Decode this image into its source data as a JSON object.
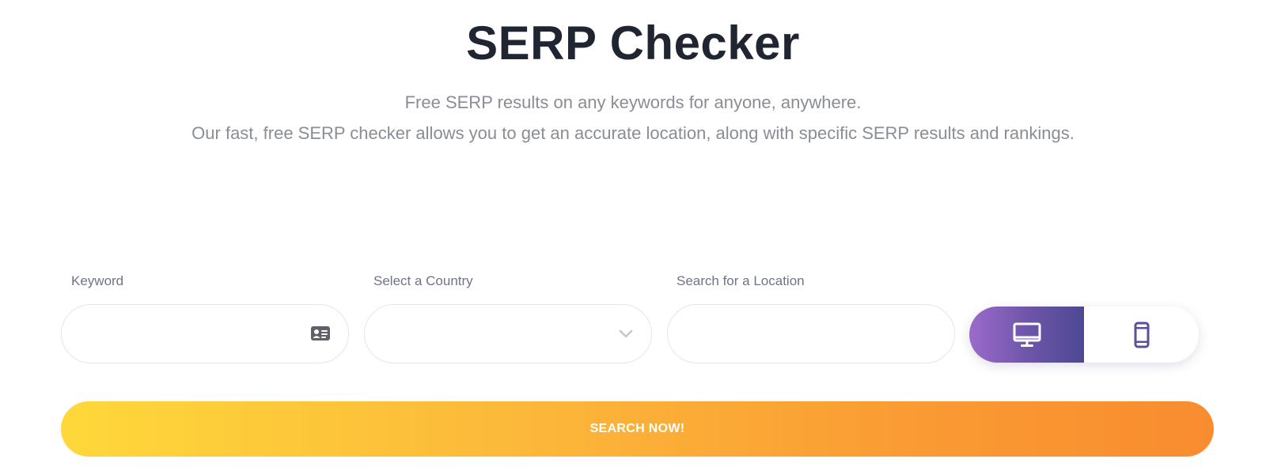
{
  "header": {
    "title": "SERP Checker",
    "subtitle_line1": "Free SERP results on any keywords for anyone, anywhere.",
    "subtitle_line2": "Our fast, free SERP checker allows you to get an accurate location, along with specific SERP results and rankings."
  },
  "form": {
    "keyword": {
      "label": "Keyword",
      "value": "",
      "placeholder": "",
      "icon": "contact-card-icon"
    },
    "country": {
      "label": "Select a Country",
      "selected": "",
      "icon": "chevron-down-icon"
    },
    "location": {
      "label": "Search for a Location",
      "value": "",
      "placeholder": ""
    },
    "device_toggle": {
      "options": [
        {
          "name": "desktop",
          "icon": "desktop-icon",
          "selected": true
        },
        {
          "name": "mobile",
          "icon": "mobile-icon",
          "selected": false
        }
      ]
    },
    "submit_label": "SEARCH NOW!"
  },
  "colors": {
    "title": "#1f2631",
    "subtitle": "#8a8d96",
    "label": "#6f7386",
    "device_active_start": "#9a6bcb",
    "device_active_end": "#4d4894",
    "mobile_icon": "#5b4f9e",
    "button_start": "#fed83a",
    "button_end": "#f98c2f"
  }
}
